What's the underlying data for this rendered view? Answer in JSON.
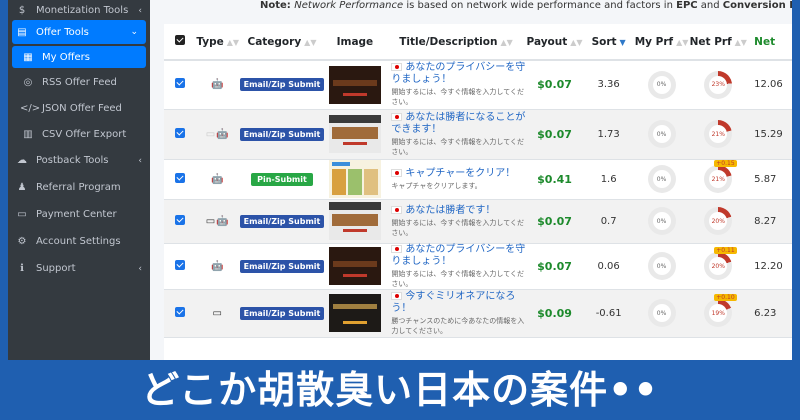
{
  "sidebar": {
    "items": [
      {
        "icon": "monetization-icon",
        "glyph": "$",
        "label": "Monetization Tools",
        "chevron": "‹",
        "state": "cut"
      },
      {
        "icon": "offer-tools-icon",
        "glyph": "▤",
        "label": "Offer Tools",
        "chevron": "⌄",
        "state": "active"
      },
      {
        "icon": "list-icon",
        "glyph": "▦",
        "label": "My Offers",
        "state": "sub-active"
      },
      {
        "icon": "rss-icon",
        "glyph": "◎",
        "label": "RSS Offer Feed",
        "state": "sub"
      },
      {
        "icon": "code-icon",
        "glyph": "</>",
        "label": "JSON Offer Feed",
        "state": "sub"
      },
      {
        "icon": "file-icon",
        "glyph": "▥",
        "label": "CSV Offer Export",
        "state": "sub"
      },
      {
        "icon": "postback-icon",
        "glyph": "☁",
        "label": "Postback Tools",
        "chevron": "‹",
        "state": "normal"
      },
      {
        "icon": "referral-icon",
        "glyph": "♟",
        "label": "Referral Program",
        "state": "normal"
      },
      {
        "icon": "payment-icon",
        "glyph": "▭",
        "label": "Payment Center",
        "state": "normal"
      },
      {
        "icon": "gear-icon",
        "glyph": "⚙",
        "label": "Account Settings",
        "state": "normal"
      },
      {
        "icon": "info-icon",
        "glyph": "ℹ",
        "label": "Support",
        "chevron": "‹",
        "state": "normal"
      }
    ]
  },
  "note": {
    "prefix": "Note: ",
    "italic": "Network Performance",
    "mid": " is based on network wide performance and factors in ",
    "b1": "EPC",
    "and": " and ",
    "b2": "Conversion Rate"
  },
  "table": {
    "headers": [
      "Type",
      "Category",
      "Image",
      "Title/Description",
      "Payout",
      "Sort",
      "My Prf",
      "Net Prf",
      "Net"
    ],
    "rows": [
      {
        "types": [
          {
            "g": "",
            "dim": false
          },
          {
            "g": "🤖",
            "dim": false
          }
        ],
        "category": "Email/Zip Submit",
        "cat_style": "blue",
        "thumb": "dark",
        "title": "あなたのプライバシーを守りましょう！",
        "desc": "開始するには、今すぐ情報を入力してください。",
        "payout": "$0.07",
        "sort": "3.36",
        "my": "0%",
        "net": "23%",
        "net_tag": "",
        "netval": "12.06"
      },
      {
        "types": [
          {
            "g": "▭",
            "dim": true
          },
          {
            "g": "",
            "dim": false
          },
          {
            "g": "🤖",
            "dim": true
          }
        ],
        "category": "Email/Zip Submit",
        "cat_style": "blue",
        "thumb": "light",
        "title": "あなたは勝者になることができます！",
        "desc": "開始するには、今すぐ情報を入力してください。",
        "payout": "$0.07",
        "sort": "1.73",
        "my": "0%",
        "net": "21%",
        "net_tag": "",
        "netval": "15.29"
      },
      {
        "types": [
          {
            "g": "",
            "dim": false
          },
          {
            "g": "🤖",
            "dim": true
          }
        ],
        "category": "Pin-Submit",
        "cat_style": "green",
        "thumb": "ad",
        "title": "キャプチャーをクリア！",
        "desc": "キャプチャをクリアします。",
        "payout": "$0.41",
        "sort": "1.6",
        "my": "0%",
        "net": "21%",
        "net_tag": "+0.15",
        "netval": "5.87"
      },
      {
        "types": [
          {
            "g": "▭",
            "dim": false
          },
          {
            "g": "",
            "dim": true
          },
          {
            "g": "🤖",
            "dim": true
          }
        ],
        "category": "Email/Zip Submit",
        "cat_style": "blue",
        "thumb": "light",
        "title": "あなたは勝者です！",
        "desc": "開始するには、今すぐ情報を入力してください。",
        "payout": "$0.07",
        "sort": "0.7",
        "my": "0%",
        "net": "20%",
        "net_tag": "",
        "netval": "8.27"
      },
      {
        "types": [
          {
            "g": "",
            "dim": false
          },
          {
            "g": "🤖",
            "dim": false
          }
        ],
        "category": "Email/Zip Submit",
        "cat_style": "blue",
        "thumb": "dark",
        "title": "あなたのプライバシーを守りましょう！",
        "desc": "開始するには、今すぐ情報を入力してください。",
        "payout": "$0.07",
        "sort": "0.06",
        "my": "0%",
        "net": "20%",
        "net_tag": "+0.11",
        "netval": "12.20"
      },
      {
        "types": [
          {
            "g": "▭",
            "dim": false
          }
        ],
        "category": "Email/Zip Submit",
        "cat_style": "blue",
        "thumb": "gold",
        "title": "今すぐミリオネアになろう！",
        "desc": "勝つチャンスのために今あなたの情報を入力してください。",
        "payout": "$0.09",
        "sort": "-0.61",
        "my": "0%",
        "net": "19%",
        "net_tag": "+0.10",
        "netval": "6.23"
      }
    ]
  },
  "banner": {
    "text": "どこか胡散臭い日本の案件••"
  },
  "colors": {
    "accent": "#007bff",
    "sidebar_bg": "#343a40",
    "payout_green": "#1d8a2c",
    "banner_blue": "#1f5fb0",
    "net_ring": "#c0392b"
  }
}
